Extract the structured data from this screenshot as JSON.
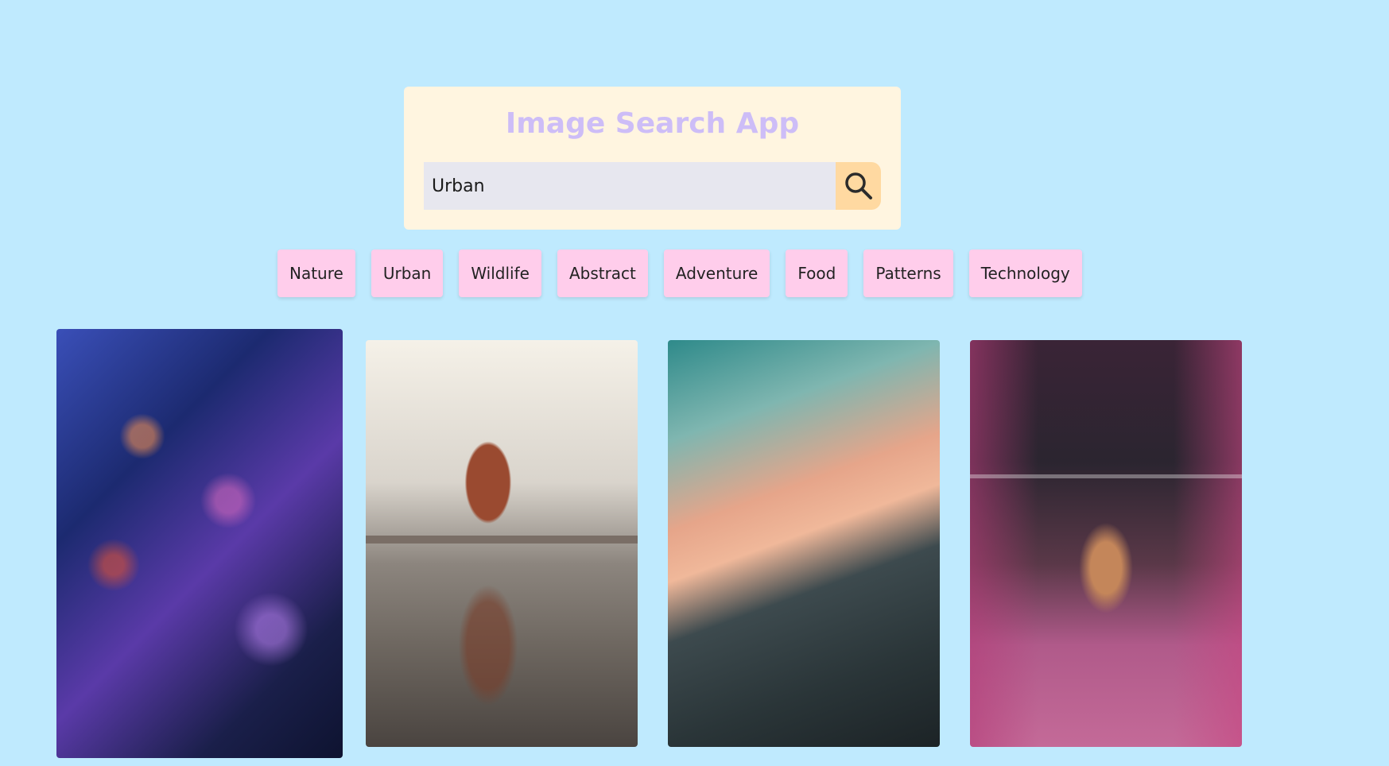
{
  "app": {
    "title": "Image Search App"
  },
  "search": {
    "value": "Urban",
    "button_icon": "search-icon"
  },
  "categories": [
    "Nature",
    "Urban",
    "Wildlife",
    "Abstract",
    "Adventure",
    "Food",
    "Patterns",
    "Technology"
  ],
  "colors": {
    "background": "#bfeafe",
    "card_background": "#fff5e0",
    "title": "#cdbdf7",
    "input_background": "#e7e7ef",
    "search_button": "#ffd9a1",
    "category_button": "#ffcdeb"
  }
}
